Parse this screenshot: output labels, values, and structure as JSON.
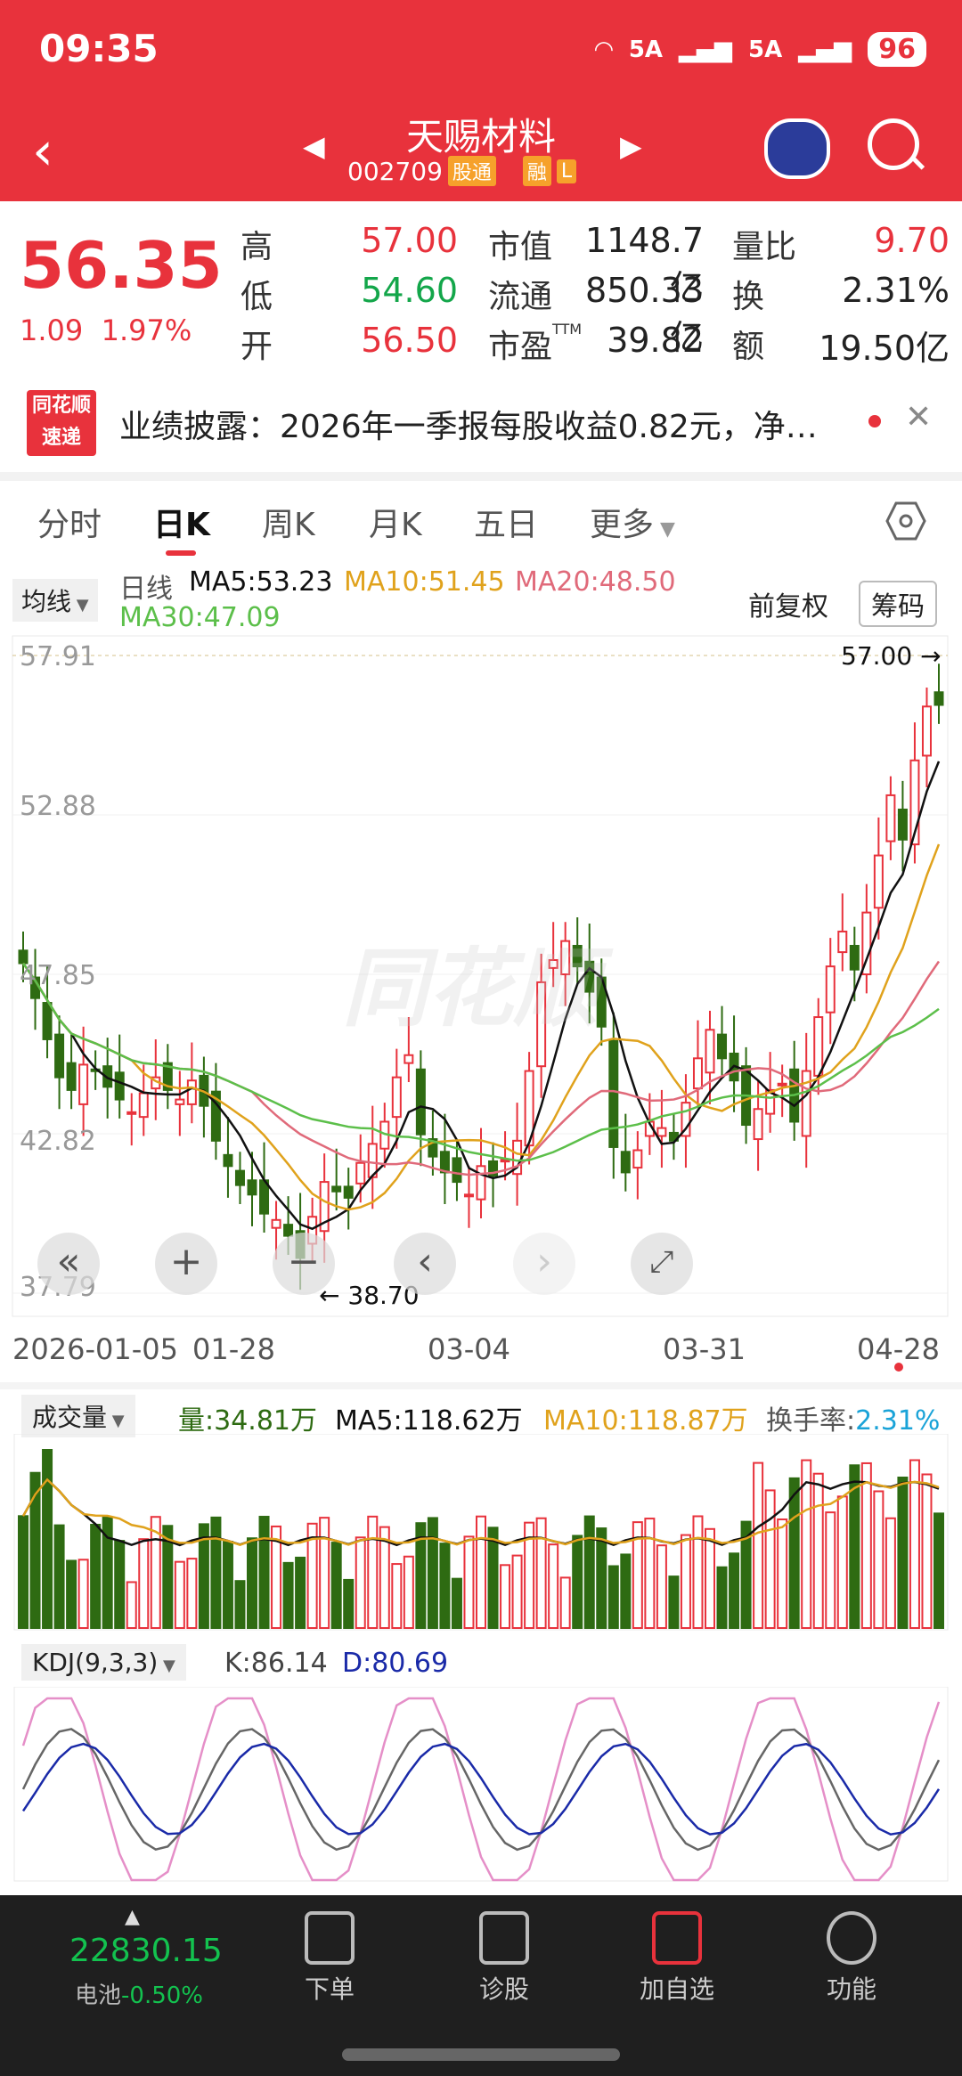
{
  "status": {
    "time": "09:35",
    "net1": "5A",
    "net2": "5A",
    "battery": "96"
  },
  "header": {
    "stock_name": "天赐材料",
    "stock_code": "002709",
    "tag1": "股通",
    "tag2": "融",
    "tag3": "L"
  },
  "quote": {
    "price": "56.35",
    "change": "1.09",
    "change_pct": "1.97%",
    "high_label": "高",
    "high": "57.00",
    "low_label": "低",
    "low": "54.60",
    "open_label": "开",
    "open": "56.50",
    "mktcap_label": "市值",
    "mktcap": "1148.7亿",
    "float_label": "流通",
    "float": "850.33亿",
    "pe_label": "市盈",
    "pe_sup": "TTM",
    "pe": "39.82",
    "volratio_label": "量比",
    "volratio": "9.70",
    "turnover_label": "换",
    "turnover": "2.31%",
    "amount_label": "额",
    "amount": "19.50亿"
  },
  "news": {
    "logo1": "同花顺",
    "logo2": "速递",
    "text": "业绩披露：2026年一季报每股收益0.82元，净…"
  },
  "tabs": [
    "分时",
    "日K",
    "周K",
    "月K",
    "五日",
    "更多"
  ],
  "kline": {
    "indicator": "均线",
    "period": "日线",
    "ma5": "MA5:53.23",
    "ma10": "MA10:51.45",
    "ma20": "MA20:48.50",
    "ma30": "MA30:47.09",
    "adjust": "前复权",
    "chips": "筹码",
    "max_label": "57.00",
    "min_label": "38.70",
    "watermark": "同花顺"
  },
  "volume": {
    "indicator": "成交量",
    "vol": "量:34.81万",
    "ma5": "MA5:118.62万",
    "ma10": "MA10:118.87万",
    "turn_label": "换手率:",
    "turn": "2.31%"
  },
  "kdj": {
    "indicator": "KDJ(9,3,3)",
    "k": "K:86.14",
    "d": "D:80.69"
  },
  "bottom": {
    "index_value": "22830.15",
    "index_name": "电池",
    "index_change": "-0.50%",
    "nav": [
      "下单",
      "诊股",
      "加自选",
      "功能"
    ]
  },
  "colors": {
    "up": "#e8323c",
    "down": "#2e6b12",
    "ma5": "#111111",
    "ma10": "#e0a21c",
    "ma20": "#e06a7a",
    "ma30": "#5cbf4a"
  },
  "chart_data": {
    "type": "candlestick",
    "ylim": [
      37.79,
      57.91
    ],
    "y_ticks": [
      "57.91",
      "52.88",
      "47.85",
      "42.82",
      "37.79"
    ],
    "x_ticks": [
      "2026-01-05",
      "01-28",
      "03-04",
      "03-31",
      "04-28"
    ],
    "series_close_approx": [
      48.2,
      47.1,
      45.8,
      44.6,
      44.2,
      45.0,
      44.8,
      44.3,
      43.9,
      43.5,
      44.1,
      44.6,
      44.2,
      43.9,
      44.5,
      43.7,
      42.6,
      41.8,
      41.2,
      40.9,
      40.3,
      40.1,
      39.6,
      38.9,
      40.2,
      41.3,
      41.0,
      40.8,
      41.9,
      42.5,
      43.2,
      44.6,
      45.3,
      42.8,
      42.1,
      41.6,
      41.3,
      40.9,
      41.8,
      41.5,
      42.0,
      42.6,
      44.8,
      47.6,
      48.3,
      48.9,
      48.1,
      47.3,
      46.2,
      42.4,
      41.6,
      42.3,
      43.2,
      43.0,
      42.6,
      43.8,
      45.2,
      46.1,
      45.2,
      44.5,
      43.1,
      43.6,
      44.2,
      44.4,
      43.2,
      44.8,
      46.5,
      48.1,
      49.2,
      48.0,
      49.8,
      51.6,
      53.5,
      52.1,
      54.6,
      56.3,
      56.35
    ]
  }
}
